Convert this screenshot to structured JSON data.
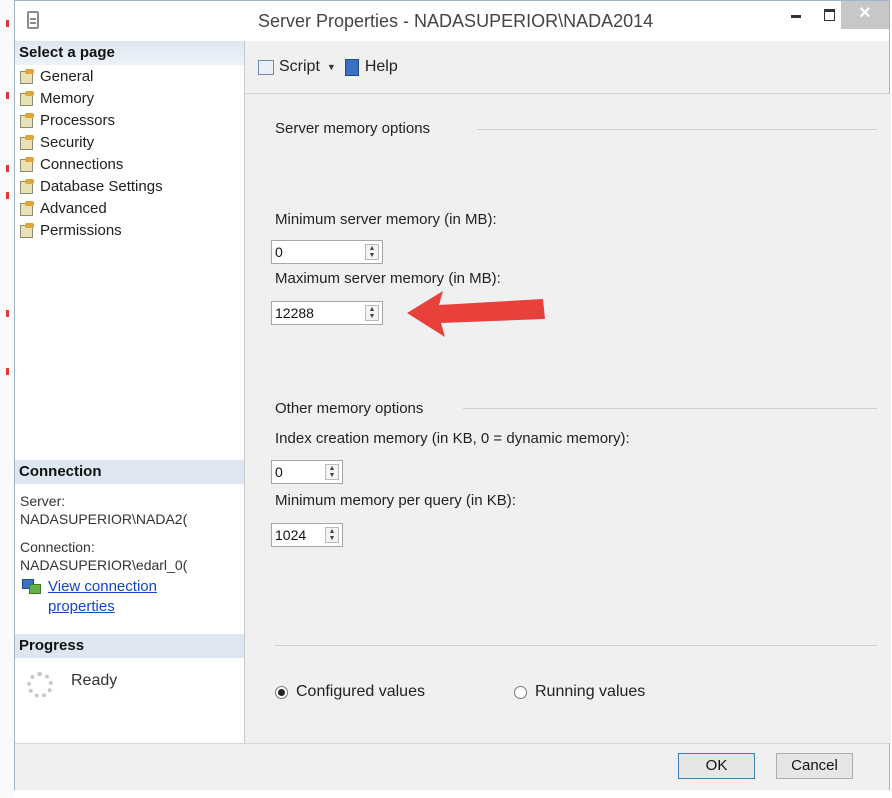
{
  "window": {
    "title": "Server Properties - NADASUPERIOR\\NADA2014",
    "close_glyph": "✕"
  },
  "left": {
    "select_header": "Select a page",
    "pages": [
      "General",
      "Memory",
      "Processors",
      "Security",
      "Connections",
      "Database Settings",
      "Advanced",
      "Permissions"
    ],
    "connection_header": "Connection",
    "server_label": "Server:",
    "server_value": "NADASUPERIOR\\NADA2(",
    "connection_label": "Connection:",
    "connection_value": "NADASUPERIOR\\edarl_0(",
    "view_link_line1": "View connection",
    "view_link_line2": "properties",
    "progress_header": "Progress",
    "progress_status": "Ready"
  },
  "toolbar": {
    "script_label": "Script",
    "help_label": "Help"
  },
  "content": {
    "server_memory_group": "Server memory options",
    "min_server_label": "Minimum server memory (in MB):",
    "min_server_value": "0",
    "max_server_label": "Maximum server memory (in MB):",
    "max_server_value": "12288",
    "other_memory_group": "Other memory options",
    "index_creation_label": "Index creation memory (in KB, 0 = dynamic memory):",
    "index_creation_value": "0",
    "min_query_label": "Minimum memory per query (in KB):",
    "min_query_value": "1024",
    "configured_label": "Configured values",
    "running_label": "Running values"
  },
  "buttons": {
    "ok": "OK",
    "cancel": "Cancel"
  },
  "colors": {
    "accent_arrow": "#e8403a",
    "link": "#1247c7",
    "header_bg": "#dde6f1"
  },
  "icons": {
    "window": "sql-document-icon",
    "page": "property-page-icon",
    "script": "script-icon",
    "help": "help-book-icon"
  }
}
